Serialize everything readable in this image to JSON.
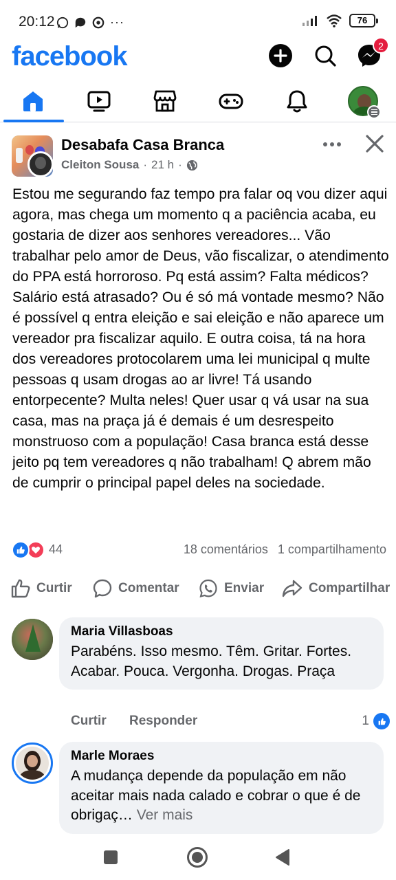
{
  "status_bar": {
    "time": "20:12",
    "battery": "76"
  },
  "header": {
    "logo": "facebook",
    "messenger_badge": "2"
  },
  "tabs": [
    {
      "name": "home",
      "icon": "home-icon",
      "active": true
    },
    {
      "name": "watch",
      "icon": "video-icon"
    },
    {
      "name": "marketplace",
      "icon": "store-icon"
    },
    {
      "name": "gaming",
      "icon": "gamepad-icon"
    },
    {
      "name": "notifications",
      "icon": "bell-icon"
    },
    {
      "name": "menu",
      "icon": "profile-menu-icon"
    }
  ],
  "post": {
    "group_name": "Desabafa Casa Branca",
    "author": "Cleiton Sousa",
    "time": "21 h",
    "text": "Estou me segurando faz tempo pra falar oq vou dizer aqui agora, mas chega um momento q a paciência acaba, eu gostaria de dizer aos senhores vereadores... Vão trabalhar pelo amor de Deus, vão fiscalizar, o atendimento do PPA está horroroso. Pq está assim? Falta médicos? Salário está atrasado? Ou é só má vontade mesmo? Não é possível q entra eleição e sai eleição e não aparece um vereador pra fiscalizar aquilo. E outra coisa, tá na hora dos vereadores protocolarem uma lei municipal q multe pessoas q usam drogas ao ar livre! Tá usando entorpecente? Multa neles! Quer usar q vá usar na sua casa, mas na praça já é demais é um desrespeito monstruoso com a população! Casa branca está desse jeito pq tem vereadores q não trabalham! Q abrem mão de cumprir o principal papel deles na sociedade.",
    "reaction_count": "44",
    "comments_count": "18 comentários",
    "shares_count": "1 compartilhamento"
  },
  "actions": {
    "like": "Curtir",
    "comment": "Comentar",
    "send": "Enviar",
    "share": "Compartilhar"
  },
  "comments": [
    {
      "name": "Maria Villasboas",
      "text": "Parabéns. Isso mesmo. Têm. Gritar. Fortes. Acabar. Pouca. Vergonha. Drogas. Praça",
      "like_label": "Curtir",
      "reply_label": "Responder",
      "likes": "1"
    },
    {
      "name": "Marle Moraes",
      "text": "A mudança depende da população em não aceitar mais nada calado e cobrar o que é de obrigaç…",
      "see_more": "Ver mais"
    }
  ],
  "colors": {
    "brand": "#1877f2",
    "muted": "#65676b",
    "bubble": "#f0f2f5",
    "badge": "#e41e3f"
  }
}
